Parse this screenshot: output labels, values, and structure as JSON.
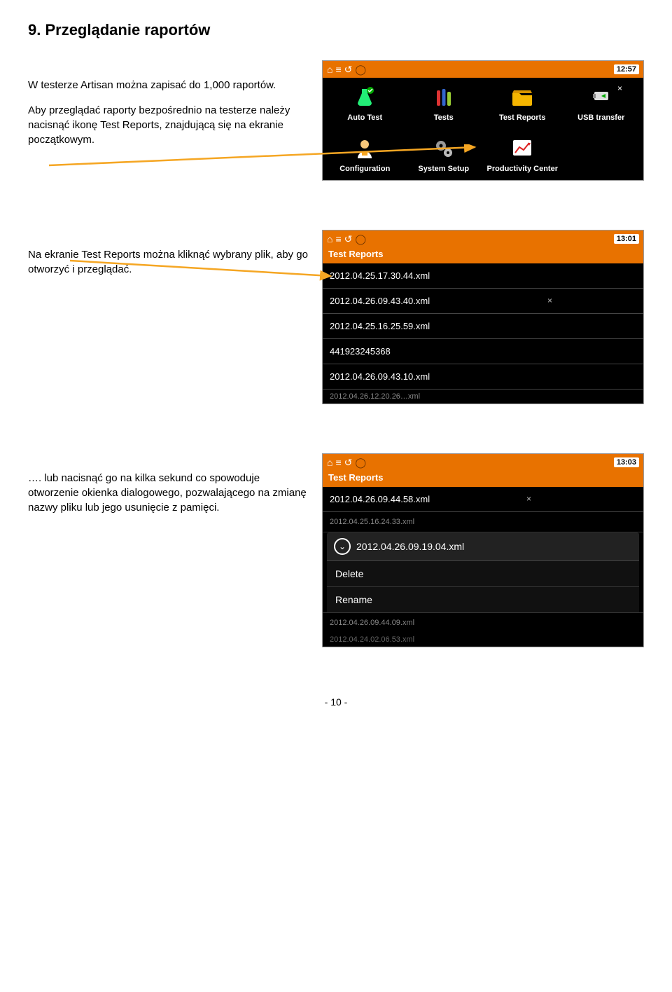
{
  "heading": "9.    Przeglądanie raportów",
  "para1": "W testerze Artisan można zapisać do 1,000 raportów.",
  "para2": "Aby przeglądać raporty bezpośrednio na testerze należy nacisnąć ikonę Test Reports, znajdującą się na ekranie początkowym.",
  "para3": "Na ekranie Test Reports można kliknąć wybrany plik, aby go otworzyć i przeglądać.",
  "para4": "…. lub nacisnąć go na kilka sekund co spowoduje otworzenie okienka dialogowego, pozwalającego na zmianę nazwy pliku lub jego usunięcie z pamięci.",
  "shot1": {
    "time": "12:57",
    "items": [
      {
        "label": "Auto Test"
      },
      {
        "label": "Tests"
      },
      {
        "label": "Test Reports"
      },
      {
        "label": "USB transfer"
      },
      {
        "label": "Configuration"
      },
      {
        "label": "System Setup"
      },
      {
        "label": "Productivity Center"
      }
    ]
  },
  "shot2": {
    "time": "13:01",
    "title": "Test Reports",
    "rows": [
      "2012.04.25.17.30.44.xml",
      "2012.04.26.09.43.40.xml",
      "2012.04.25.16.25.59.xml",
      "441923245368",
      "2012.04.26.09.43.10.xml"
    ],
    "cutoff": "2012.04.26.12.20.26…xml"
  },
  "shot3": {
    "time": "13:03",
    "title": "Test Reports",
    "rows_top": [
      "2012.04.26.09.44.58.xml"
    ],
    "row_faded_top": "2012.04.25.16.24.33.xml",
    "dialog": {
      "file": "2012.04.26.09.19.04.xml",
      "opt1": "Delete",
      "opt2": "Rename"
    },
    "row_faded_bot": "2012.04.26.09.44.09.xml",
    "row_cut": "2012.04.24.02.06.53.xml"
  },
  "page": "- 10 -"
}
